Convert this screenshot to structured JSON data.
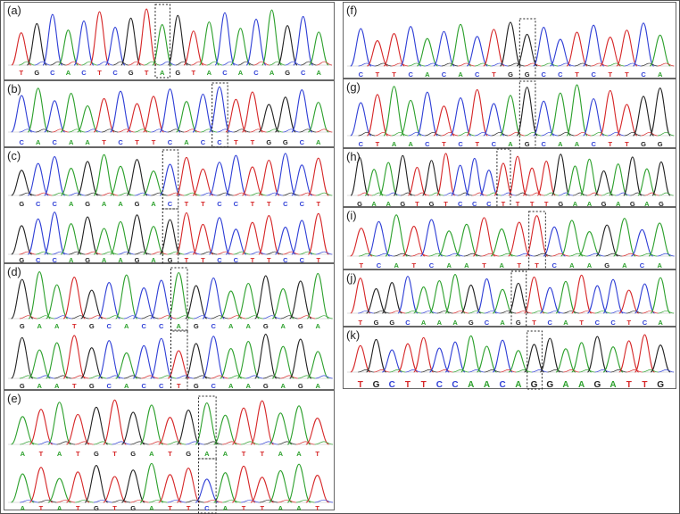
{
  "colors": {
    "A": "#2ca02c",
    "C": "#2f3fd6",
    "G": "#222222",
    "T": "#d62728",
    "mix": "#9e9e9e"
  },
  "panels": [
    {
      "id": "a",
      "label": "(a)",
      "tracks": [
        {
          "seq": "TGCACTCGTAGTACACAGCA",
          "mut": 9
        }
      ]
    },
    {
      "id": "b",
      "label": "(b)",
      "tracks": [
        {
          "seq": "CACAATCTTCACCTTGGCA",
          "mut": 12
        }
      ]
    },
    {
      "id": "c",
      "label": "(c)",
      "tracks": [
        {
          "seq": "GCCAGAAGACTTCCTTCCT",
          "mut": 9
        },
        {
          "seq": "GCCAGAAGAGTTCCTTCCT",
          "mut": 9
        }
      ]
    },
    {
      "id": "d",
      "label": "(d)",
      "tracks": [
        {
          "seq": "GAATGCACCAGCAAGAGA",
          "mut": 9
        },
        {
          "seq": "GAATGCACCTGCAAGAGA",
          "mut": 9
        }
      ]
    },
    {
      "id": "e",
      "label": "(e)",
      "tracks": [
        {
          "seq": "ATATGTGATGAATTAAT",
          "mut": 10
        },
        {
          "seq": "ATATGTGATTCATTAAT",
          "mut": 10
        }
      ]
    },
    {
      "id": "f",
      "label": "(f)",
      "tracks": [
        {
          "seq": "CTTCACACTGGCCTCTTCA",
          "mut": 10
        }
      ]
    },
    {
      "id": "g",
      "label": "(g)",
      "tracks": [
        {
          "seq": "CTAACTCTCAGCAACTTGG",
          "mut": 10
        }
      ]
    },
    {
      "id": "h",
      "label": "(h)",
      "tracks": [
        {
          "seq": "GAAGTGTCCCTTTTGAAGAGAG",
          "mut": 10
        }
      ]
    },
    {
      "id": "i",
      "label": "(i)",
      "tracks": [
        {
          "seq": "TCATCAATATTCAAGACA",
          "mut": 10
        }
      ]
    },
    {
      "id": "j",
      "label": "(j)",
      "tracks": [
        {
          "seq": "TGGCAAAGCAGTCATCCTCA",
          "mut": 10
        }
      ]
    },
    {
      "id": "k",
      "label": "(k)",
      "tracks": [
        {
          "seq": "TGCTTCCAACAGGAAGATTG",
          "mut": 11
        }
      ]
    }
  ]
}
